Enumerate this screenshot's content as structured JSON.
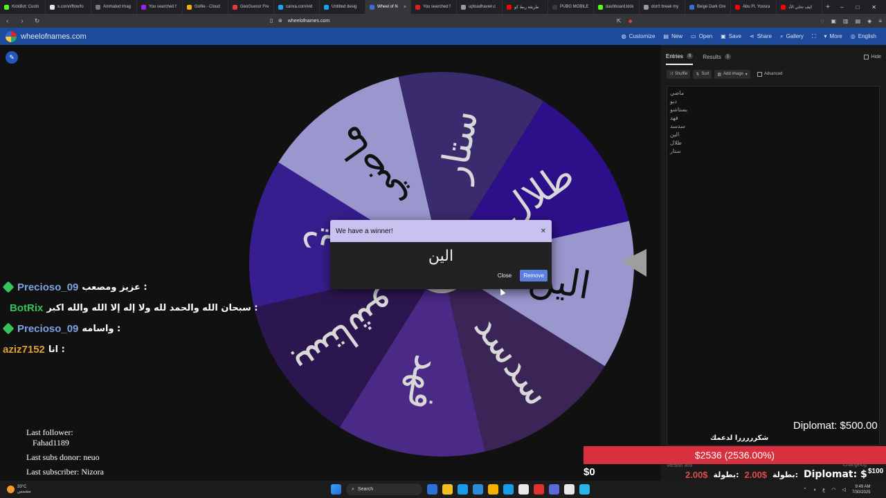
{
  "browser": {
    "tabs": [
      {
        "title": "KickBot: Custo",
        "color": "#53fc18",
        "active": false
      },
      {
        "title": "x.com/i/flow/lo",
        "color": "#e6e6e6",
        "active": false
      },
      {
        "title": "Animated imag",
        "color": "#7a7a7a",
        "active": false
      },
      {
        "title": "You searched f",
        "color": "#a020f0",
        "active": false
      },
      {
        "title": "Gofile - Cloud",
        "color": "#f5b000",
        "active": false
      },
      {
        "title": "GeoGuessr Fre",
        "color": "#e03a3a",
        "active": false
      },
      {
        "title": "canva.com/vid",
        "color": "#1da1f2",
        "active": false
      },
      {
        "title": "Untitled desig",
        "color": "#1da1f2",
        "active": false
      },
      {
        "title": "Wheel of N",
        "color": "#3b6fd8",
        "active": true
      },
      {
        "title": "You searched f",
        "color": "#e02020",
        "active": false
      },
      {
        "title": "uploadhaven.c",
        "color": "#9a9a9a",
        "active": false
      },
      {
        "title": "طريقة ربط كو",
        "color": "#ff0000",
        "active": false
      },
      {
        "title": "PUBG MOBILE",
        "color": "#3a3a3a",
        "active": false
      },
      {
        "title": "dashboard.kick",
        "color": "#53fc18",
        "active": false
      },
      {
        "title": "don't break my",
        "color": "#9a9a9a",
        "active": false
      },
      {
        "title": "Beige Dark Gre",
        "color": "#3b6fd8",
        "active": false
      },
      {
        "title": "Abu Ft. Yousra",
        "color": "#ff0000",
        "active": false
      },
      {
        "title": "كيف تخلي الأد",
        "color": "#ff0000",
        "active": false
      }
    ],
    "active_close": "×",
    "new_tab": "+",
    "url": "wheelofnames.com",
    "window_controls": [
      "–",
      "□",
      "✕"
    ]
  },
  "site": {
    "name": "wheelofnames.com",
    "nav": [
      {
        "label": "Customize",
        "icon": "palette-icon",
        "glyph": "◍"
      },
      {
        "label": "New",
        "icon": "file-icon",
        "glyph": "▤"
      },
      {
        "label": "Open",
        "icon": "folder-icon",
        "glyph": "▭"
      },
      {
        "label": "Save",
        "icon": "save-icon",
        "glyph": "▣"
      },
      {
        "label": "Share",
        "icon": "share-icon",
        "glyph": "⋖"
      },
      {
        "label": "Gallery",
        "icon": "search-icon",
        "glyph": "⌕"
      },
      {
        "label": "",
        "icon": "fullscreen-icon",
        "glyph": "⛶"
      },
      {
        "label": "More",
        "icon": "chevron-down-icon",
        "glyph": "▾"
      },
      {
        "label": "English",
        "icon": "globe-icon",
        "glyph": "◎"
      }
    ]
  },
  "wheel": {
    "segments": [
      {
        "label": "ستار",
        "color": "#3a2a6e"
      },
      {
        "label": "طلال",
        "color": "#2e0f8a"
      },
      {
        "label": "الين",
        "color": "#9a97cf"
      },
      {
        "label": "سدسد",
        "color": "#3b2456"
      },
      {
        "label": "فهد",
        "color": "#4a2a86"
      },
      {
        "label": "بستاشو",
        "color": "#2c1650"
      },
      {
        "label": "ديو",
        "color": "#371e8f"
      },
      {
        "label": "ماضي",
        "color": "#9a97cf"
      }
    ]
  },
  "modal": {
    "title": "We have a winner!",
    "winner": "الين",
    "close_label": "Close",
    "remove_label": "Remove"
  },
  "panel": {
    "tab_entries": "Entries",
    "entries_count": "8",
    "tab_results": "Results",
    "results_count": "1",
    "hide_label": "Hide",
    "shuffle_label": "Shuffle",
    "sort_label": "Sort",
    "add_image_label": "Add image",
    "advanced_label": "Advanced",
    "entries": [
      "ماضي",
      "ديو",
      "بستاشو",
      "فهد",
      "سدسد",
      "الين",
      "طلال",
      "ستار"
    ],
    "version": "Version 369",
    "changelog": "Changelog"
  },
  "chat": [
    {
      "user": "Precioso_09",
      "user_color": "#7fa3e0",
      "message": ": عزيز ومصعب",
      "badges": [
        "diamond"
      ]
    },
    {
      "user": "BotRix",
      "user_color": "#35c45a",
      "message": ": سبحان الله والحمد لله ولا إله إلا الله والله اكبر",
      "badges": [
        "box",
        "check"
      ]
    },
    {
      "user": "Precioso_09",
      "user_color": "#7fa3e0",
      "message": ": واسامه",
      "badges": [
        "diamond"
      ]
    },
    {
      "user": "aziz7152",
      "user_color": "#e0a030",
      "message": ": انا",
      "badges": []
    }
  ],
  "overlay": {
    "last_follower_label": "Last follower:",
    "last_follower": "Fahad1189",
    "last_subs_donor": "Last subs donor: neuo",
    "last_subscriber": "Last subscriber: Nizora",
    "top_goal": "Diplomat: $500.00",
    "thanks": "شكرررررا لدعمك",
    "goal_bar": "$2536 (2536.00%)",
    "goal_progress": 1.0,
    "goal_start": "$0",
    "goal_end": "$100",
    "ticker": [
      "2.00$",
      "بطولة:",
      "2.00$",
      "بطولة:",
      "Diplomat: $"
    ]
  },
  "taskbar": {
    "weather_temp": "33°C",
    "weather_desc": "مشمس",
    "search_label": "Search",
    "time": "9:49 AM",
    "date": "7/30/2025",
    "apps": [
      "#2e6fd8",
      "#f0c020",
      "#1a9be8",
      "#2a8cd8",
      "#f5b000",
      "#1a9be8",
      "#e8e8e8",
      "#e03030",
      "#5a6bd8",
      "#e8e8e8",
      "#2ab5e8"
    ]
  }
}
